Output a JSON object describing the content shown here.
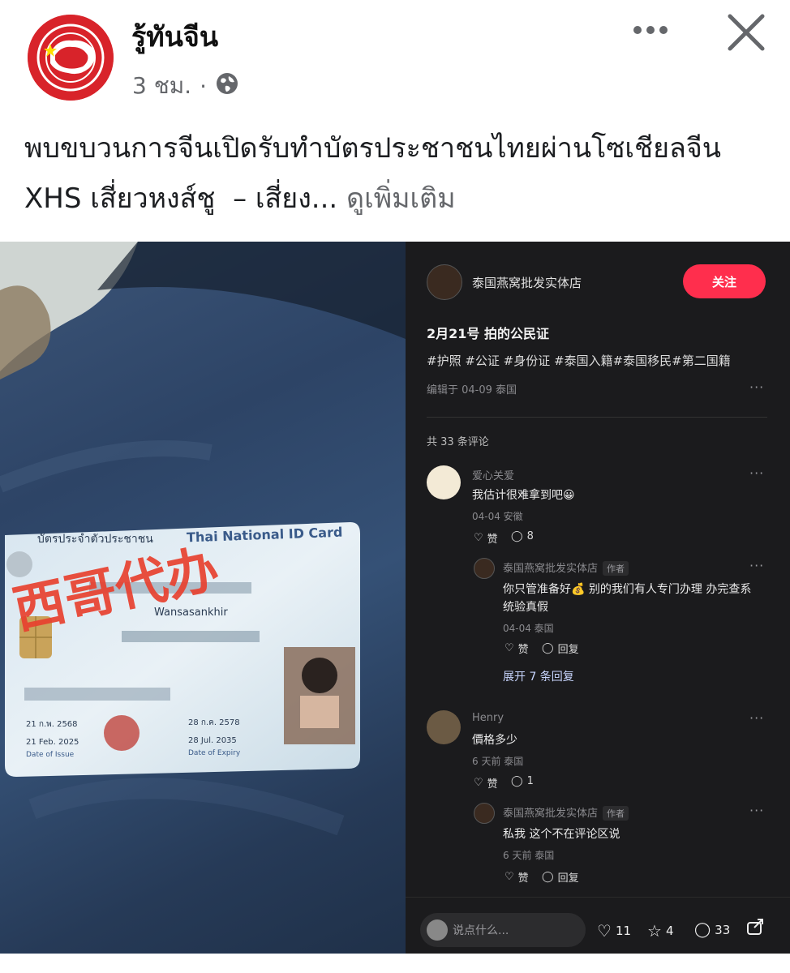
{
  "post": {
    "page_name": "รู้ทันจีน",
    "time": "3 ชม.",
    "separator": "·",
    "text": "พบขบวนการจีนเปิดรับทำบัตรประชาชนไทยผ่านโซเชียลจีน XHS เสี่ยวหงส์ชู ￼ – เสี่ยง...",
    "see_more": "ดูเพิ่มเติม",
    "icons": {
      "more": "more-horizontal-icon",
      "close": "close-icon",
      "audience": "globe-icon"
    }
  },
  "photo": {
    "stamp_text": "西哥代办",
    "card_title_th": "บัตรประจำตัวประชาชน",
    "card_title_en": "Thai National ID Card",
    "card_name": "Wansasankhir",
    "issue_date_th": "21 ก.พ. 2568",
    "issue_date_en": "21 Feb. 2025",
    "issue_label": "Date of Issue",
    "expiry_date_th": "28 ก.ค. 2578",
    "expiry_date_en": "28 Jul. 2035",
    "expiry_label": "Date of Expiry"
  },
  "xhs": {
    "author": "泰国燕窝批发实体店",
    "follow": "关注",
    "title": "2月21号 拍的公民证",
    "tags": "#护照 #公证 #身份证 #泰国入籍#泰国移民#第二国籍",
    "edited": "编辑于 04-09 泰国",
    "comment_count": "共 33 条评论",
    "comments": [
      {
        "user": "爱心关爱",
        "text": "我估计很难拿到吧😀",
        "meta": "04-04 安徽",
        "like": "赞",
        "replies": "8"
      },
      {
        "user": "泰国燕窝批发实体店",
        "badge": "作者",
        "text1": "你只管准备好💰 别的我们有人专门办理 办完查系",
        "text2": "统验真假",
        "meta": "04-04 泰国",
        "like": "赞",
        "reply": "回复"
      },
      {
        "expand": "展开 7 条回复"
      },
      {
        "user": "Henry",
        "text": "價格多少",
        "meta": "6 天前 泰国",
        "like": "赞",
        "replies": "1"
      },
      {
        "user": "泰国燕窝批发实体店",
        "badge": "作者",
        "text": "私我 这个不在评论区说",
        "meta": "6 天前 泰国",
        "like": "赞",
        "reply": "回复"
      }
    ],
    "input_placeholder": "说点什么...",
    "likes": "11",
    "stars": "4",
    "comments_total": "33",
    "colors": {
      "follow": "#ff2e4d",
      "background": "#1b1b1d"
    }
  }
}
